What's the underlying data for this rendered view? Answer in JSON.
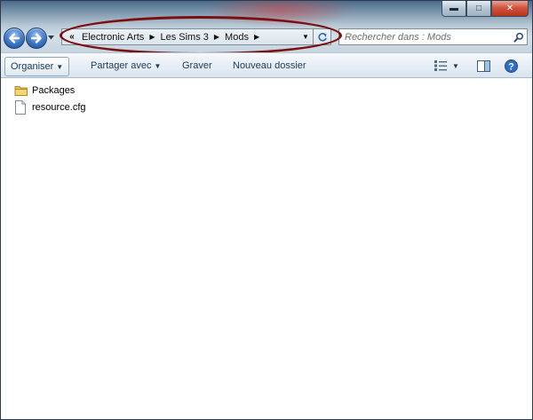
{
  "window": {
    "controls": {
      "minimize": "▬",
      "maximize": "□",
      "close": "✕"
    }
  },
  "navigation": {
    "address_prefix": "«",
    "breadcrumb": [
      "Electronic Arts",
      "Les Sims 3",
      "Mods"
    ],
    "search_placeholder": "Rechercher dans : Mods"
  },
  "toolbar": {
    "organize_label": "Organiser",
    "share_label": "Partager avec",
    "burn_label": "Graver",
    "new_folder_label": "Nouveau dossier"
  },
  "files": [
    {
      "name": "Packages",
      "type": "folder",
      "icon": "folder-icon"
    },
    {
      "name": "resource.cfg",
      "type": "file",
      "icon": "file-icon"
    }
  ],
  "colors": {
    "highlight": "#7a1010",
    "toolbar_text": "#1e395b",
    "nav_button": "#3b74c6"
  }
}
